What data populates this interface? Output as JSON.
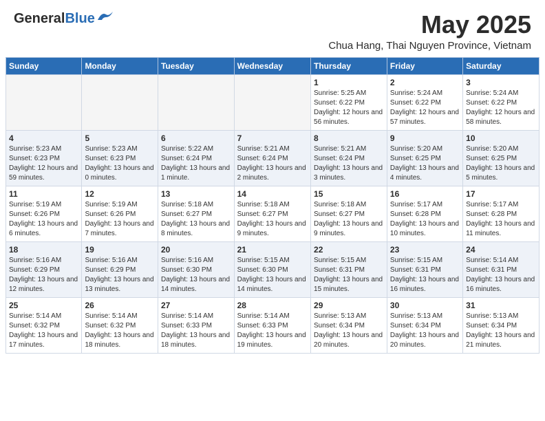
{
  "header": {
    "logo_general": "General",
    "logo_blue": "Blue",
    "month_title": "May 2025",
    "location": "Chua Hang, Thai Nguyen Province, Vietnam"
  },
  "weekdays": [
    "Sunday",
    "Monday",
    "Tuesday",
    "Wednesday",
    "Thursday",
    "Friday",
    "Saturday"
  ],
  "weeks": [
    [
      {
        "day": "",
        "empty": true
      },
      {
        "day": "",
        "empty": true
      },
      {
        "day": "",
        "empty": true
      },
      {
        "day": "",
        "empty": true
      },
      {
        "day": "1",
        "sunrise": "5:25 AM",
        "sunset": "6:22 PM",
        "daylight": "12 hours and 56 minutes."
      },
      {
        "day": "2",
        "sunrise": "5:24 AM",
        "sunset": "6:22 PM",
        "daylight": "12 hours and 57 minutes."
      },
      {
        "day": "3",
        "sunrise": "5:24 AM",
        "sunset": "6:22 PM",
        "daylight": "12 hours and 58 minutes."
      }
    ],
    [
      {
        "day": "4",
        "sunrise": "5:23 AM",
        "sunset": "6:23 PM",
        "daylight": "12 hours and 59 minutes."
      },
      {
        "day": "5",
        "sunrise": "5:23 AM",
        "sunset": "6:23 PM",
        "daylight": "13 hours and 0 minutes."
      },
      {
        "day": "6",
        "sunrise": "5:22 AM",
        "sunset": "6:24 PM",
        "daylight": "13 hours and 1 minute."
      },
      {
        "day": "7",
        "sunrise": "5:21 AM",
        "sunset": "6:24 PM",
        "daylight": "13 hours and 2 minutes."
      },
      {
        "day": "8",
        "sunrise": "5:21 AM",
        "sunset": "6:24 PM",
        "daylight": "13 hours and 3 minutes."
      },
      {
        "day": "9",
        "sunrise": "5:20 AM",
        "sunset": "6:25 PM",
        "daylight": "13 hours and 4 minutes."
      },
      {
        "day": "10",
        "sunrise": "5:20 AM",
        "sunset": "6:25 PM",
        "daylight": "13 hours and 5 minutes."
      }
    ],
    [
      {
        "day": "11",
        "sunrise": "5:19 AM",
        "sunset": "6:26 PM",
        "daylight": "13 hours and 6 minutes."
      },
      {
        "day": "12",
        "sunrise": "5:19 AM",
        "sunset": "6:26 PM",
        "daylight": "13 hours and 7 minutes."
      },
      {
        "day": "13",
        "sunrise": "5:18 AM",
        "sunset": "6:27 PM",
        "daylight": "13 hours and 8 minutes."
      },
      {
        "day": "14",
        "sunrise": "5:18 AM",
        "sunset": "6:27 PM",
        "daylight": "13 hours and 9 minutes."
      },
      {
        "day": "15",
        "sunrise": "5:18 AM",
        "sunset": "6:27 PM",
        "daylight": "13 hours and 9 minutes."
      },
      {
        "day": "16",
        "sunrise": "5:17 AM",
        "sunset": "6:28 PM",
        "daylight": "13 hours and 10 minutes."
      },
      {
        "day": "17",
        "sunrise": "5:17 AM",
        "sunset": "6:28 PM",
        "daylight": "13 hours and 11 minutes."
      }
    ],
    [
      {
        "day": "18",
        "sunrise": "5:16 AM",
        "sunset": "6:29 PM",
        "daylight": "13 hours and 12 minutes."
      },
      {
        "day": "19",
        "sunrise": "5:16 AM",
        "sunset": "6:29 PM",
        "daylight": "13 hours and 13 minutes."
      },
      {
        "day": "20",
        "sunrise": "5:16 AM",
        "sunset": "6:30 PM",
        "daylight": "13 hours and 14 minutes."
      },
      {
        "day": "21",
        "sunrise": "5:15 AM",
        "sunset": "6:30 PM",
        "daylight": "13 hours and 14 minutes."
      },
      {
        "day": "22",
        "sunrise": "5:15 AM",
        "sunset": "6:31 PM",
        "daylight": "13 hours and 15 minutes."
      },
      {
        "day": "23",
        "sunrise": "5:15 AM",
        "sunset": "6:31 PM",
        "daylight": "13 hours and 16 minutes."
      },
      {
        "day": "24",
        "sunrise": "5:14 AM",
        "sunset": "6:31 PM",
        "daylight": "13 hours and 16 minutes."
      }
    ],
    [
      {
        "day": "25",
        "sunrise": "5:14 AM",
        "sunset": "6:32 PM",
        "daylight": "13 hours and 17 minutes."
      },
      {
        "day": "26",
        "sunrise": "5:14 AM",
        "sunset": "6:32 PM",
        "daylight": "13 hours and 18 minutes."
      },
      {
        "day": "27",
        "sunrise": "5:14 AM",
        "sunset": "6:33 PM",
        "daylight": "13 hours and 18 minutes."
      },
      {
        "day": "28",
        "sunrise": "5:14 AM",
        "sunset": "6:33 PM",
        "daylight": "13 hours and 19 minutes."
      },
      {
        "day": "29",
        "sunrise": "5:13 AM",
        "sunset": "6:34 PM",
        "daylight": "13 hours and 20 minutes."
      },
      {
        "day": "30",
        "sunrise": "5:13 AM",
        "sunset": "6:34 PM",
        "daylight": "13 hours and 20 minutes."
      },
      {
        "day": "31",
        "sunrise": "5:13 AM",
        "sunset": "6:34 PM",
        "daylight": "13 hours and 21 minutes."
      }
    ]
  ]
}
